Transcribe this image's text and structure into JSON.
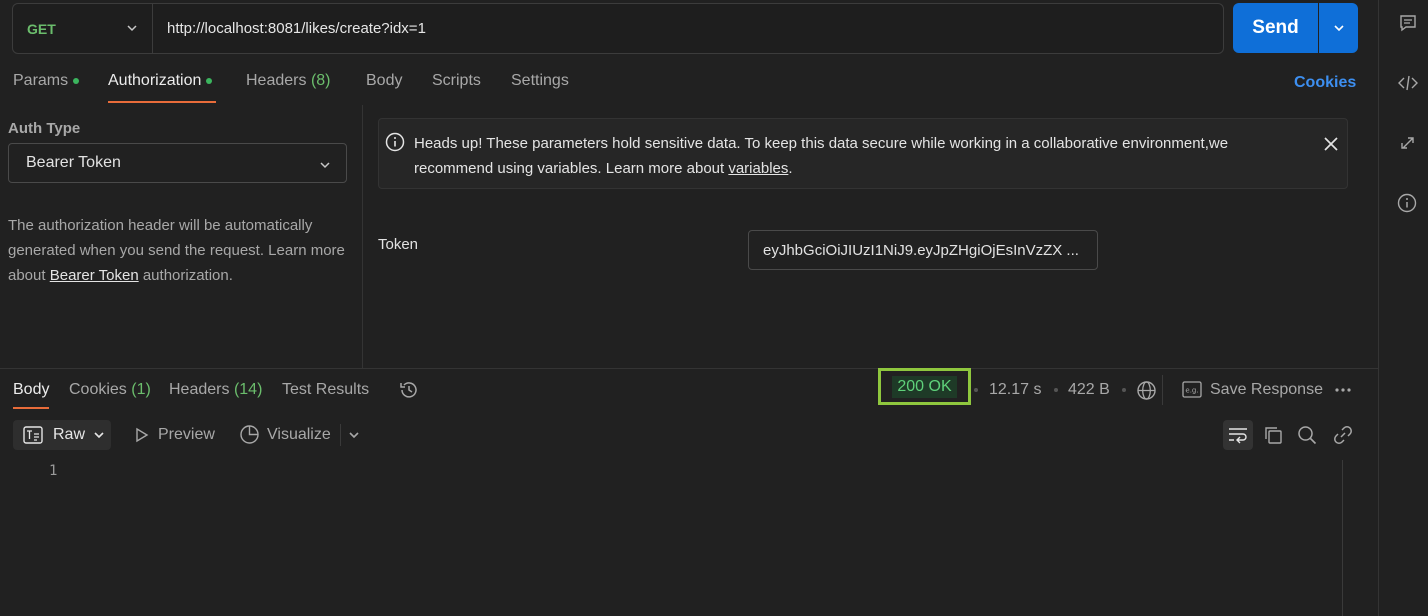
{
  "request": {
    "method": "GET",
    "url": "http://localhost:8081/likes/create?idx=1",
    "send_label": "Send"
  },
  "request_tabs": {
    "params": "Params",
    "authorization": "Authorization",
    "headers": "Headers",
    "headers_count": "(8)",
    "body": "Body",
    "scripts": "Scripts",
    "settings": "Settings",
    "cookies": "Cookies"
  },
  "auth": {
    "type_label": "Auth Type",
    "selected_type": "Bearer Token",
    "desc_part1": "The authorization header will be automatically generated when you send the request. Learn more about ",
    "desc_link": "Bearer Token",
    "desc_part2": " authorization."
  },
  "alert": {
    "text": "Heads up! These parameters hold sensitive data. To keep this data secure while working in a collaborative environment,we recommend using variables. Learn more about ",
    "link": "variables",
    "tail": "."
  },
  "token": {
    "label": "Token",
    "value": "eyJhbGciOiJIUzI1NiJ9.eyJpZHgiOjEsInVzZX ..."
  },
  "response_tabs": {
    "body": "Body",
    "cookies": "Cookies",
    "cookies_count": "(1)",
    "headers": "Headers",
    "headers_count": "(14)",
    "test_results": "Test Results"
  },
  "response_meta": {
    "status": "200 OK",
    "time": "12.17 s",
    "size": "422 B",
    "save_response": "Save Response"
  },
  "response_toolbar": {
    "raw": "Raw",
    "preview": "Preview",
    "visualize": "Visualize"
  },
  "response_body": {
    "line_numbers": [
      "1"
    ]
  },
  "colors": {
    "accent_blue": "#0f6fd8",
    "status_green": "#5fd17a",
    "tab_underline": "#e86c3a",
    "highlight_box": "#8fc73e"
  }
}
